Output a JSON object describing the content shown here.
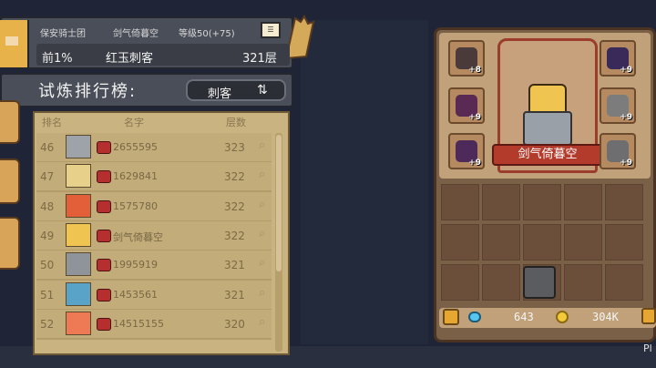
{
  "player_info": {
    "guild": "保安骑士团",
    "name": "剑气倚暮空",
    "level": "等级50(+75)",
    "rank_percent": "前1%",
    "class_title": "红玉刺客",
    "floor": "321层"
  },
  "leaderboard": {
    "title": "试炼排行榜:",
    "class_filter": "刺客",
    "switch_icon": "swap-arrows-icon",
    "headers": {
      "rank": "排名",
      "name": "名字",
      "floors": "层数"
    },
    "rows": [
      {
        "rank": "46",
        "name": "2655595",
        "floors": "323",
        "avatar_color": "#9ea3aa"
      },
      {
        "rank": "47",
        "name": "1629841",
        "floors": "322",
        "avatar_color": "#e7d08a"
      },
      {
        "rank": "48",
        "name": "1575780",
        "floors": "322",
        "avatar_color": "#e25f3a"
      },
      {
        "rank": "49",
        "name": "剑气倚暮空",
        "floors": "322",
        "avatar_color": "#f0c451"
      },
      {
        "rank": "50",
        "name": "1995919",
        "floors": "321",
        "avatar_color": "#8f949b"
      },
      {
        "rank": "51",
        "name": "1453561",
        "floors": "321",
        "avatar_color": "#5aa3c8"
      },
      {
        "rank": "52",
        "name": "14515155",
        "floors": "320",
        "avatar_color": "#ee7a55"
      }
    ]
  },
  "equipment": {
    "hero_name": "剑气倚暮空",
    "slots": [
      {
        "plus": "+8",
        "color": "#4b3a3a"
      },
      {
        "plus": "+9",
        "color": "#5a2a55"
      },
      {
        "plus": "+9",
        "color": "#4e2a5a"
      },
      {
        "plus": "+9",
        "color": "#3a2a5a"
      },
      {
        "plus": "+9",
        "color": "#7c7c7c"
      },
      {
        "plus": "+9",
        "color": "#6e6e70"
      }
    ]
  },
  "currency": {
    "gems": "643",
    "coins": "304K"
  },
  "corner_text": "Pl"
}
